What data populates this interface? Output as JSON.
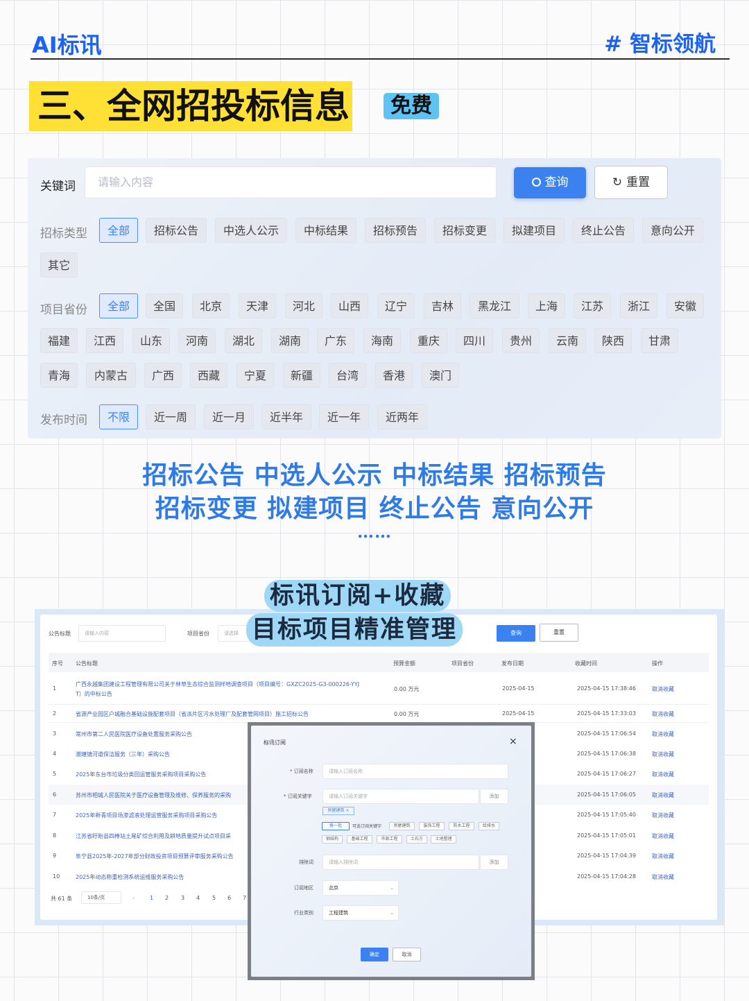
{
  "header": {
    "brand": "AI标讯",
    "tag": "# 智标领航"
  },
  "section": {
    "title": "三、全网招投标信息",
    "badge": "免费"
  },
  "search": {
    "keyword_label": "关键词",
    "placeholder": "请输入内容",
    "query_button": "查询",
    "reset_button": "重置"
  },
  "filters": {
    "type_label": "招标类型",
    "types": [
      "全部",
      "招标公告",
      "中选人公示",
      "中标结果",
      "招标预告",
      "招标变更",
      "拟建项目",
      "终止公告",
      "意向公开",
      "其它"
    ],
    "province_label": "项目省份",
    "provinces": [
      "全部",
      "全国",
      "北京",
      "天津",
      "河北",
      "山西",
      "辽宁",
      "吉林",
      "黑龙江",
      "上海",
      "江苏",
      "浙江",
      "安徽",
      "福建",
      "江西",
      "山东",
      "河南",
      "湖北",
      "湖南",
      "广东",
      "海南",
      "重庆",
      "四川",
      "贵州",
      "云南",
      "陕西",
      "甘肃",
      "青海",
      "内蒙古",
      "广西",
      "西藏",
      "宁夏",
      "新疆",
      "台湾",
      "香港",
      "澳门"
    ],
    "time_label": "发布时间",
    "times": [
      "不限",
      "近一周",
      "近一月",
      "近半年",
      "近一年",
      "近两年"
    ]
  },
  "promo": {
    "line1": "招标公告 中选人公示 中标结果 招标预告",
    "line2": "招标变更 拟建项目 终止公告 意向公开",
    "ellipsis": "……",
    "feature1": "标讯订阅+收藏",
    "feature2": "目标项目精准管理"
  },
  "mini": {
    "title_label": "公告标题",
    "title_placeholder": "请输入内容",
    "prov_label": "项目省份",
    "prov_placeholder": "请选择",
    "query": "查询",
    "reset": "重置",
    "columns": [
      "序号",
      "公告标题",
      "预算金额",
      "项目省份",
      "发布日期",
      "收藏时间",
      "操作"
    ],
    "rows": [
      {
        "no": "1",
        "title": "广西永越集团建设工程管理有限公司关于林草生态综合监测样地调查项目（项目编号：GXZC2025-G3-000226-YYJ",
        "title2": "T）的中标公告",
        "amount": "0.00 万元",
        "date": "2025-04-15",
        "fav": "2025-04-15 17:38:46",
        "op": "取消收藏"
      },
      {
        "no": "2",
        "title": "省源产业园区户城融合基础设施配套项目（省派片区污水处理厂及配套管网项目）施工招标公告",
        "amount": "0.00 万元",
        "date": "2025-04-15",
        "fav": "2025-04-15 17:33:03",
        "op": "取消收藏"
      },
      {
        "no": "3",
        "title": "常州市第二人民医院医疗设备处置服务采购公告",
        "fav": "2025-04-15 17:06:54",
        "op": "取消收藏"
      },
      {
        "no": "4",
        "title": "潮塘镇河道保洁服务（三年）采购公告",
        "fav": "2025-04-15 17:06:38",
        "op": "取消收藏"
      },
      {
        "no": "5",
        "title": "2025年东台市垃圾分类回运管服务采购项目采购公告",
        "fav": "2025-04-15 17:06:27",
        "op": "取消收藏"
      },
      {
        "no": "6",
        "title": "苏州市相城人民医院关于医疗设备管理及维修、保养服务的采购",
        "fav": "2025-04-15 17:06:05",
        "op": "取消收藏"
      },
      {
        "no": "7",
        "title": "2025年新青项目场渗滤液处理运营服务采购项目采购公告",
        "fav": "2025-04-15 17:05:40",
        "op": "取消收藏"
      },
      {
        "no": "8",
        "title": "江苏省盱眙县四棒站土尾矿综合利用及耕地质量提升试点项目采",
        "fav": "2025-04-15 17:05:01",
        "op": "取消收藏"
      },
      {
        "no": "9",
        "title": "阜宁县2025年-2027年部分财政投资项目预算评审服务采购公告",
        "fav": "2025-04-15 17:04:39",
        "op": "取消收藏"
      },
      {
        "no": "10",
        "title": "2025年动态称重检测系统运维服务采购公告",
        "fav": "2025-04-15 17:04:28",
        "op": "取消收藏"
      }
    ],
    "footer": {
      "total": "共 61 条",
      "per_page": "10条/页",
      "pages": [
        "1",
        "2",
        "3",
        "4",
        "5",
        "6",
        "7"
      ]
    }
  },
  "modal": {
    "title": "标讯订阅",
    "close": "×",
    "name_label": "* 订阅名称",
    "name_placeholder": "请输入订阅名称",
    "kw_label": "* 订阅关键字",
    "kw_placeholder": "请输入订阅关键字",
    "add": "添加",
    "selected_tag": "房屋建筑 ×",
    "suggest_row1": [
      "换一批",
      "可选订阅关键字",
      "房屋建筑",
      "装饰工程",
      "防水工程",
      "给排水"
    ],
    "suggest_row2": [
      "钢结构",
      "基础工程",
      "市政工程",
      "土石方",
      "土地整理"
    ],
    "exclude_label": "排除词",
    "exclude_placeholder": "请输入排除词",
    "region_label": "订阅地区",
    "region_value": "北京",
    "industry_label": "行业类别",
    "industry_value": "工程建筑",
    "ok": "确定",
    "cancel": "取消"
  }
}
